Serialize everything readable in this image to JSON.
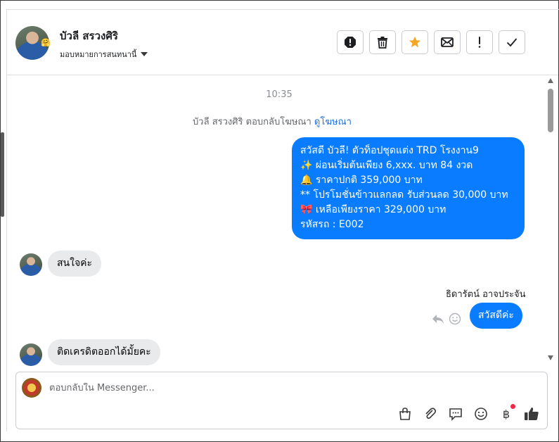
{
  "header": {
    "contact_name": "บัวลี สรวงศิริ",
    "assign_label": "มอบหมายการสนทนานี้",
    "avatar_emoji": "🤗"
  },
  "actions": [
    {
      "name": "mark-spam-button",
      "icon": "exclamation-octagon-icon"
    },
    {
      "name": "delete-button",
      "icon": "trash-icon"
    },
    {
      "name": "star-button",
      "icon": "star-icon",
      "color": "#f5a623"
    },
    {
      "name": "mark-unread-button",
      "icon": "envelope-icon"
    },
    {
      "name": "follow-up-button",
      "icon": "exclamation-icon"
    },
    {
      "name": "mark-done-button",
      "icon": "checkmark-icon"
    }
  ],
  "conversation": {
    "timestamp": "10:35",
    "reply_note_prefix": "บัวลี สรวงศิริ ตอบกลับโฆษณา",
    "reply_note_link": "ดูโฆษณา",
    "ad_message_lines": [
      "สวัสดี บัวลี! ตัวท็อปชุดแต่ง TRD โรงงาน9",
      "✨  ผ่อนเริ่มต้นเพียง 6,xxx. บาท 84 งวด",
      "🔔 ราคาปกติ 359,000 บาท",
      "** โปรโมชั่นข้าวแลกลด รับส่วนลด 30,000 บาท",
      "🎀  เหลือเพียงราคา 329,000 บาท",
      " รหัสรถ : E002"
    ],
    "incoming_1": "สนใจค่ะ",
    "agent_name": "ธิดารัตน์ อาจประจัน",
    "outgoing_1": "สวัสดีค่ะ",
    "incoming_2": "ติดเครดิตออกได้มั้ยคะ"
  },
  "composer": {
    "placeholder": "ตอบกลับใน Messenger...",
    "baht_symbol": "฿"
  },
  "colors": {
    "outgoing_bubble": "#0a7cff",
    "incoming_bubble": "#e9eaec",
    "link": "#216fdb",
    "notification_dot": "#f0284a"
  }
}
